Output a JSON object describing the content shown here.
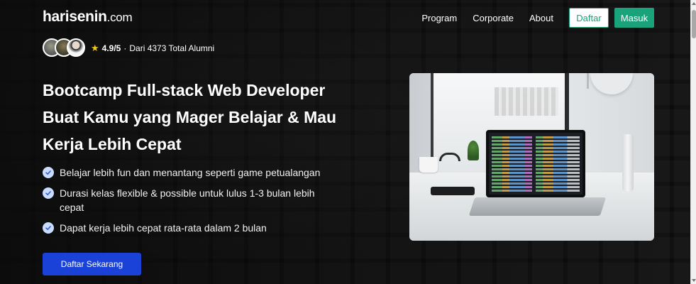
{
  "header": {
    "logo_main": "harisenin",
    "logo_suffix": ".com",
    "nav": [
      "Program",
      "Corporate",
      "About"
    ],
    "daftar_label": "Daftar",
    "masuk_label": "Masuk"
  },
  "social_proof": {
    "rating": "4.9/5",
    "separator": "·",
    "alumni_text": "Dari 4373 Total Alumni"
  },
  "hero": {
    "title_lines": [
      "Bootcamp Full-stack Web Developer",
      "Buat Kamu yang Mager Belajar & Mau",
      "Kerja Lebih Cepat"
    ],
    "features": [
      "Belajar lebih fun dan menantang seperti game petualangan",
      "Durasi kelas flexible & possible untuk lulus 1-3 bulan lebih cepat",
      "Dapat kerja lebih cepat rata-rata dalam 2 bulan"
    ],
    "cta_label": "Daftar Sekarang"
  },
  "colors": {
    "brand_green": "#1aa37a",
    "cta_blue": "#1a42d9",
    "star": "#f5c518",
    "check_bg": "#c9dcff"
  },
  "icons": {
    "rating": "star-icon",
    "feature": "check-circle-icon"
  }
}
